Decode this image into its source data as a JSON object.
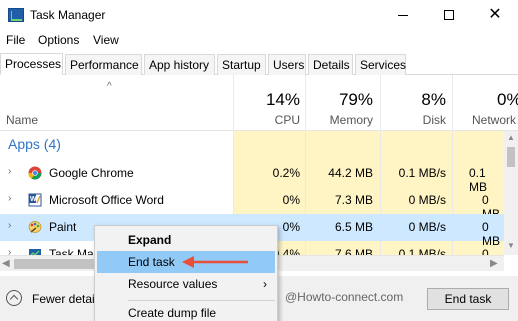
{
  "window": {
    "title": "Task Manager"
  },
  "menu": [
    "File",
    "Options",
    "View"
  ],
  "tabs": [
    "Processes",
    "Performance",
    "App history",
    "Startup",
    "Users",
    "Details",
    "Services"
  ],
  "columns": {
    "name": "Name",
    "cpu": {
      "pct": "14%",
      "label": "CPU"
    },
    "memory": {
      "pct": "79%",
      "label": "Memory"
    },
    "disk": {
      "pct": "8%",
      "label": "Disk"
    },
    "network": {
      "pct": "0%",
      "label": "Network"
    }
  },
  "group": "Apps (4)",
  "rows": [
    {
      "name": "Google Chrome",
      "cpu": "0.2%",
      "memory": "44.2 MB",
      "disk": "0.1 MB/s",
      "network": "0.1 MB",
      "icon": "chrome-icon"
    },
    {
      "name": "Microsoft Office Word",
      "cpu": "0%",
      "memory": "7.3 MB",
      "disk": "0 MB/s",
      "network": "0 MB",
      "icon": "word-icon"
    },
    {
      "name": "Paint",
      "cpu": "0%",
      "memory": "6.5 MB",
      "disk": "0 MB/s",
      "network": "0 MB",
      "icon": "paint-icon"
    },
    {
      "name": "Task Ma",
      "cpu": "0.4%",
      "memory": "7.6 MB",
      "disk": "0.1 MB/s",
      "network": "0 MB",
      "icon": "task-manager-icon"
    }
  ],
  "context_menu": {
    "items": [
      "Expand",
      "End task",
      "Resource values",
      "Create dump file"
    ],
    "submenu_arrow": "›"
  },
  "footer": {
    "fewer_details": "Fewer detai",
    "end_task": "End task"
  },
  "watermark": "@Howto-connect.com",
  "colors": {
    "selected_row": "#cde8ff",
    "highlight": "#91c9f7",
    "heat": "#fff4c4",
    "arrow": "#e8503a",
    "group": "#2f76c5"
  }
}
